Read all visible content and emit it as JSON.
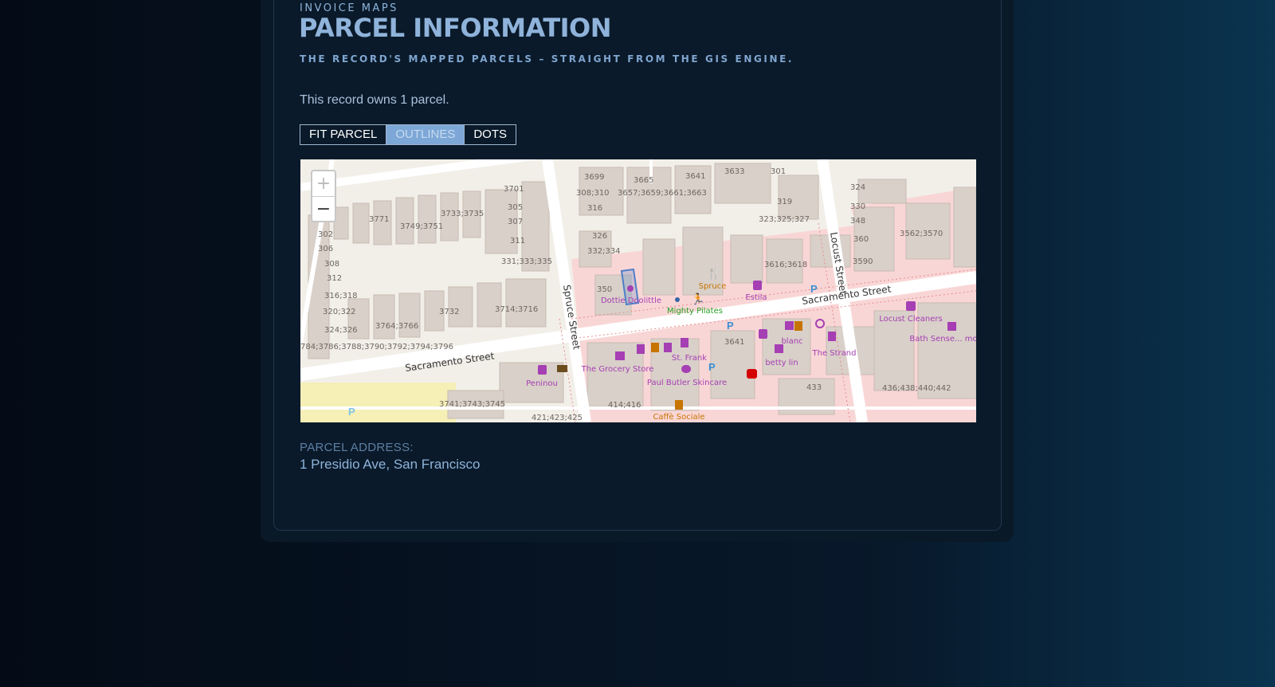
{
  "header": {
    "eyebrow": "INVOICE MAPS",
    "title": "PARCEL INFORMATION",
    "subtitle": "THE RECORD'S MAPPED PARCELS – STRAIGHT FROM THE GIS ENGINE."
  },
  "summary": "This record owns 1 parcel.",
  "controls": {
    "fit_label": "FIT PARCEL",
    "outlines_label": "OUTLINES",
    "dots_label": "DOTS",
    "active": "OUTLINES"
  },
  "map": {
    "zoom_in": "+",
    "zoom_out": "−",
    "streets": [
      "Sacramento Street",
      "Sacramento Street",
      "Spruce Street",
      "Locust Street"
    ],
    "address_numbers": [
      "3699",
      "3665",
      "3641",
      "3633",
      "301",
      "3701",
      "308;310",
      "3657;3659;3661;3663",
      "319",
      "324",
      "316",
      "323;325;327",
      "330",
      "3771",
      "3733;3735",
      "305",
      "348",
      "302",
      "3749;3751",
      "307",
      "326",
      "360",
      "3562;3570",
      "306",
      "311",
      "332;334",
      "308",
      "331;333;335",
      "3616;3618",
      "3590",
      "312",
      "316;318",
      "350",
      "320;322",
      "3732",
      "3714;3716",
      "324;326",
      "3764;3766",
      "3641",
      "784;3786;3788;3790;3792;3794;3796",
      "433",
      "436;438;440;442",
      "3741;3743;3745",
      "414;416",
      "421;423;425"
    ],
    "poi_labels": [
      "Spruce",
      "Estila",
      "Dottie Doolittle",
      "Mighty Pilates",
      "blanc",
      "The Strand",
      "betty lin",
      "St. Frank",
      "The Grocery Store",
      "Paul Butler Skincare",
      "Peninou",
      "Caffè Sociale",
      "Locust Cleaners",
      "Bath Sense... more"
    ]
  },
  "address": {
    "label": "PARCEL ADDRESS:",
    "value": "1 Presidio Ave, San Francisco"
  },
  "colors": {
    "accent": "#8fb3da",
    "button_active": "#7da7d6",
    "commercial_zone": "#f9d6d6",
    "building": "#d9d0c9",
    "poi_purple": "#a53fb3",
    "poi_orange": "#c77400",
    "parcel_outline": "#4d7fc8"
  }
}
